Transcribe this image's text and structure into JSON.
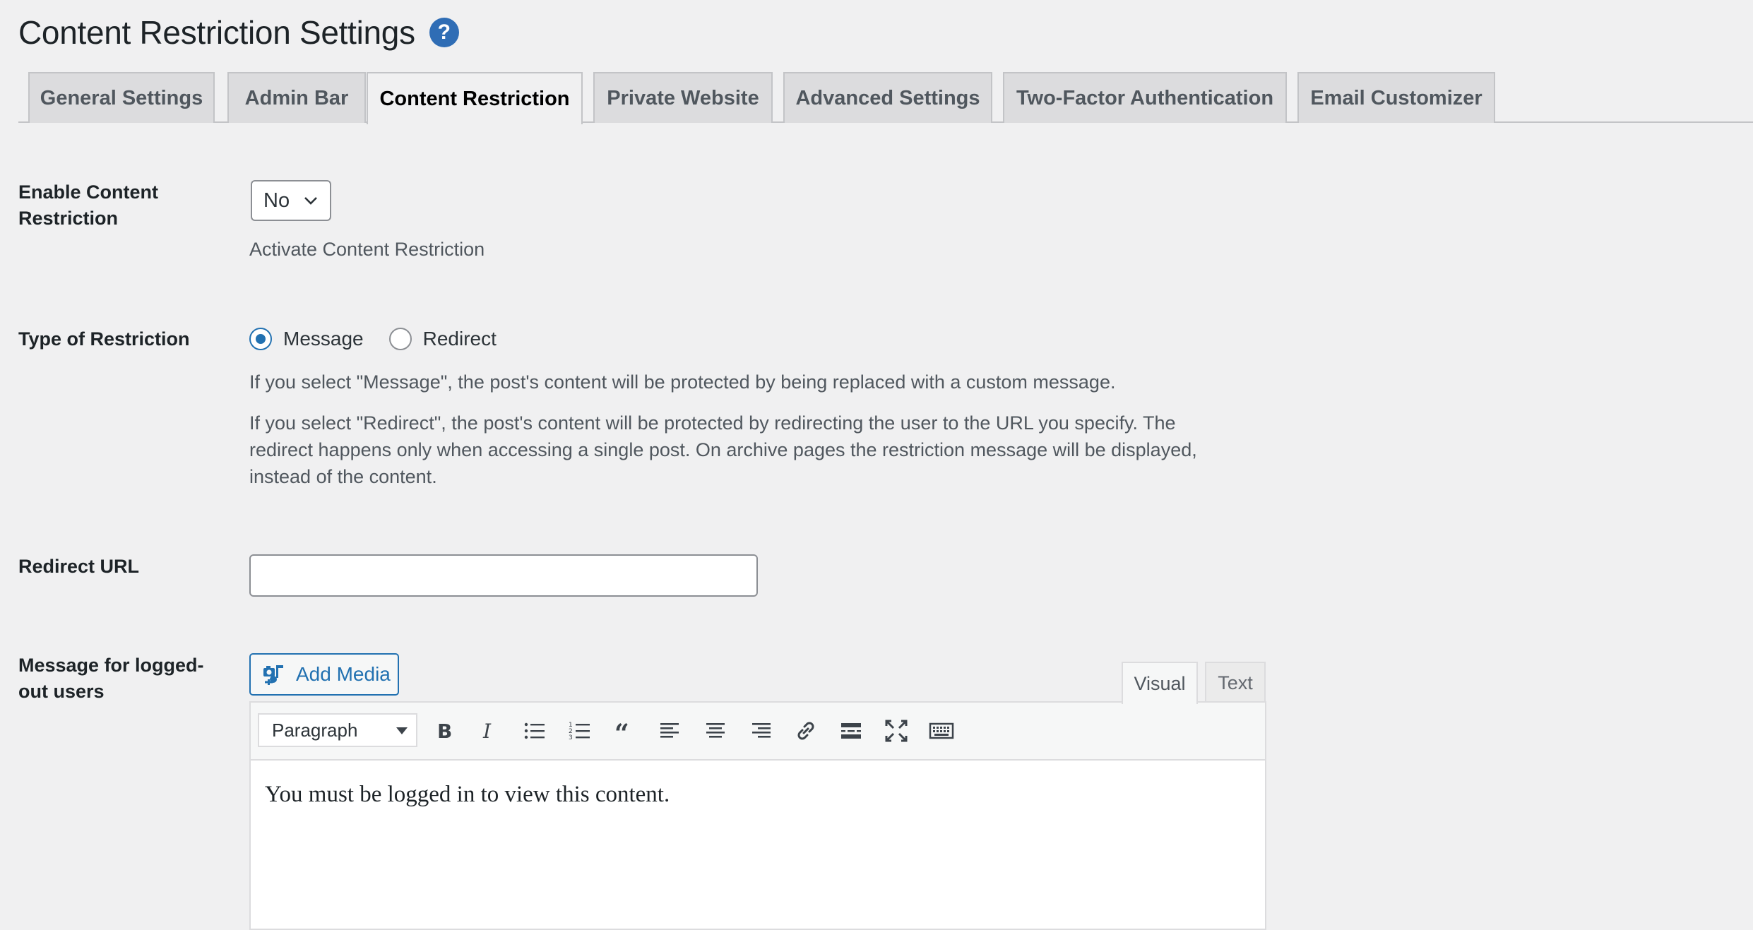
{
  "header": {
    "title": "Content Restriction Settings",
    "help_glyph": "?"
  },
  "tabs": [
    {
      "label": "General Settings"
    },
    {
      "label": "Admin Bar"
    },
    {
      "label": "Content Restriction",
      "active": true
    },
    {
      "label": "Private Website"
    },
    {
      "label": "Advanced Settings"
    },
    {
      "label": "Two-Factor Authentication"
    },
    {
      "label": "Email Customizer"
    }
  ],
  "enable_restriction": {
    "label": "Enable Content Restriction",
    "selected": "No",
    "description": "Activate Content Restriction"
  },
  "restriction_type": {
    "label": "Type of Restriction",
    "options": [
      {
        "label": "Message",
        "checked": true
      },
      {
        "label": "Redirect",
        "checked": false
      }
    ],
    "desc_message": "If you select \"Message\", the post's content will be protected by being replaced with a custom message.",
    "desc_redirect": "If you select \"Redirect\", the post's content will be protected by redirecting the user to the URL you specify. The redirect happens only when accessing a single post. On archive pages the restriction message will be displayed, instead of the content."
  },
  "redirect_url": {
    "label": "Redirect URL",
    "value": ""
  },
  "logged_out_message": {
    "label": "Message for logged-out users",
    "add_media": "Add Media",
    "tab_visual": "Visual",
    "tab_text": "Text",
    "format": "Paragraph",
    "content": "You must be logged in to view this content."
  },
  "colors": {
    "accent": "#2271b1",
    "background": "#f0f0f1",
    "help": "#2f6db5"
  }
}
